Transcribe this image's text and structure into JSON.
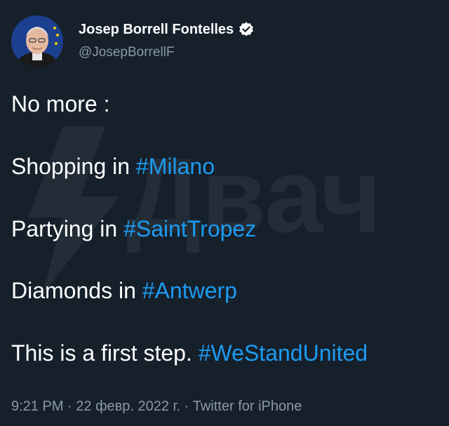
{
  "author": {
    "display_name": "Josep Borrell Fontelles",
    "handle": "@JosepBorrellF",
    "verified": true,
    "verified_icon": "verified-badge-icon",
    "avatar": "profile-photo"
  },
  "tweet": {
    "lines": [
      {
        "text": "No more :",
        "hashtag": ""
      },
      {
        "text": "Shopping in ",
        "hashtag": "#Milano"
      },
      {
        "text": "Partying in ",
        "hashtag": "#SaintTropez"
      },
      {
        "text": "Diamonds in ",
        "hashtag": "#Antwerp"
      },
      {
        "text": "This is a first step. ",
        "hashtag": "#WeStandUnited"
      }
    ]
  },
  "meta": {
    "time": "9:21 PM",
    "date": "22 февр. 2022 г.",
    "source": "Twitter for iPhone",
    "separator": " · "
  },
  "watermark": {
    "text": "Двач",
    "icon": "lightning-logo-icon"
  },
  "colors": {
    "background": "#15202b",
    "text": "#ffffff",
    "secondary": "#8b98a5",
    "link": "#1d9bf0"
  }
}
